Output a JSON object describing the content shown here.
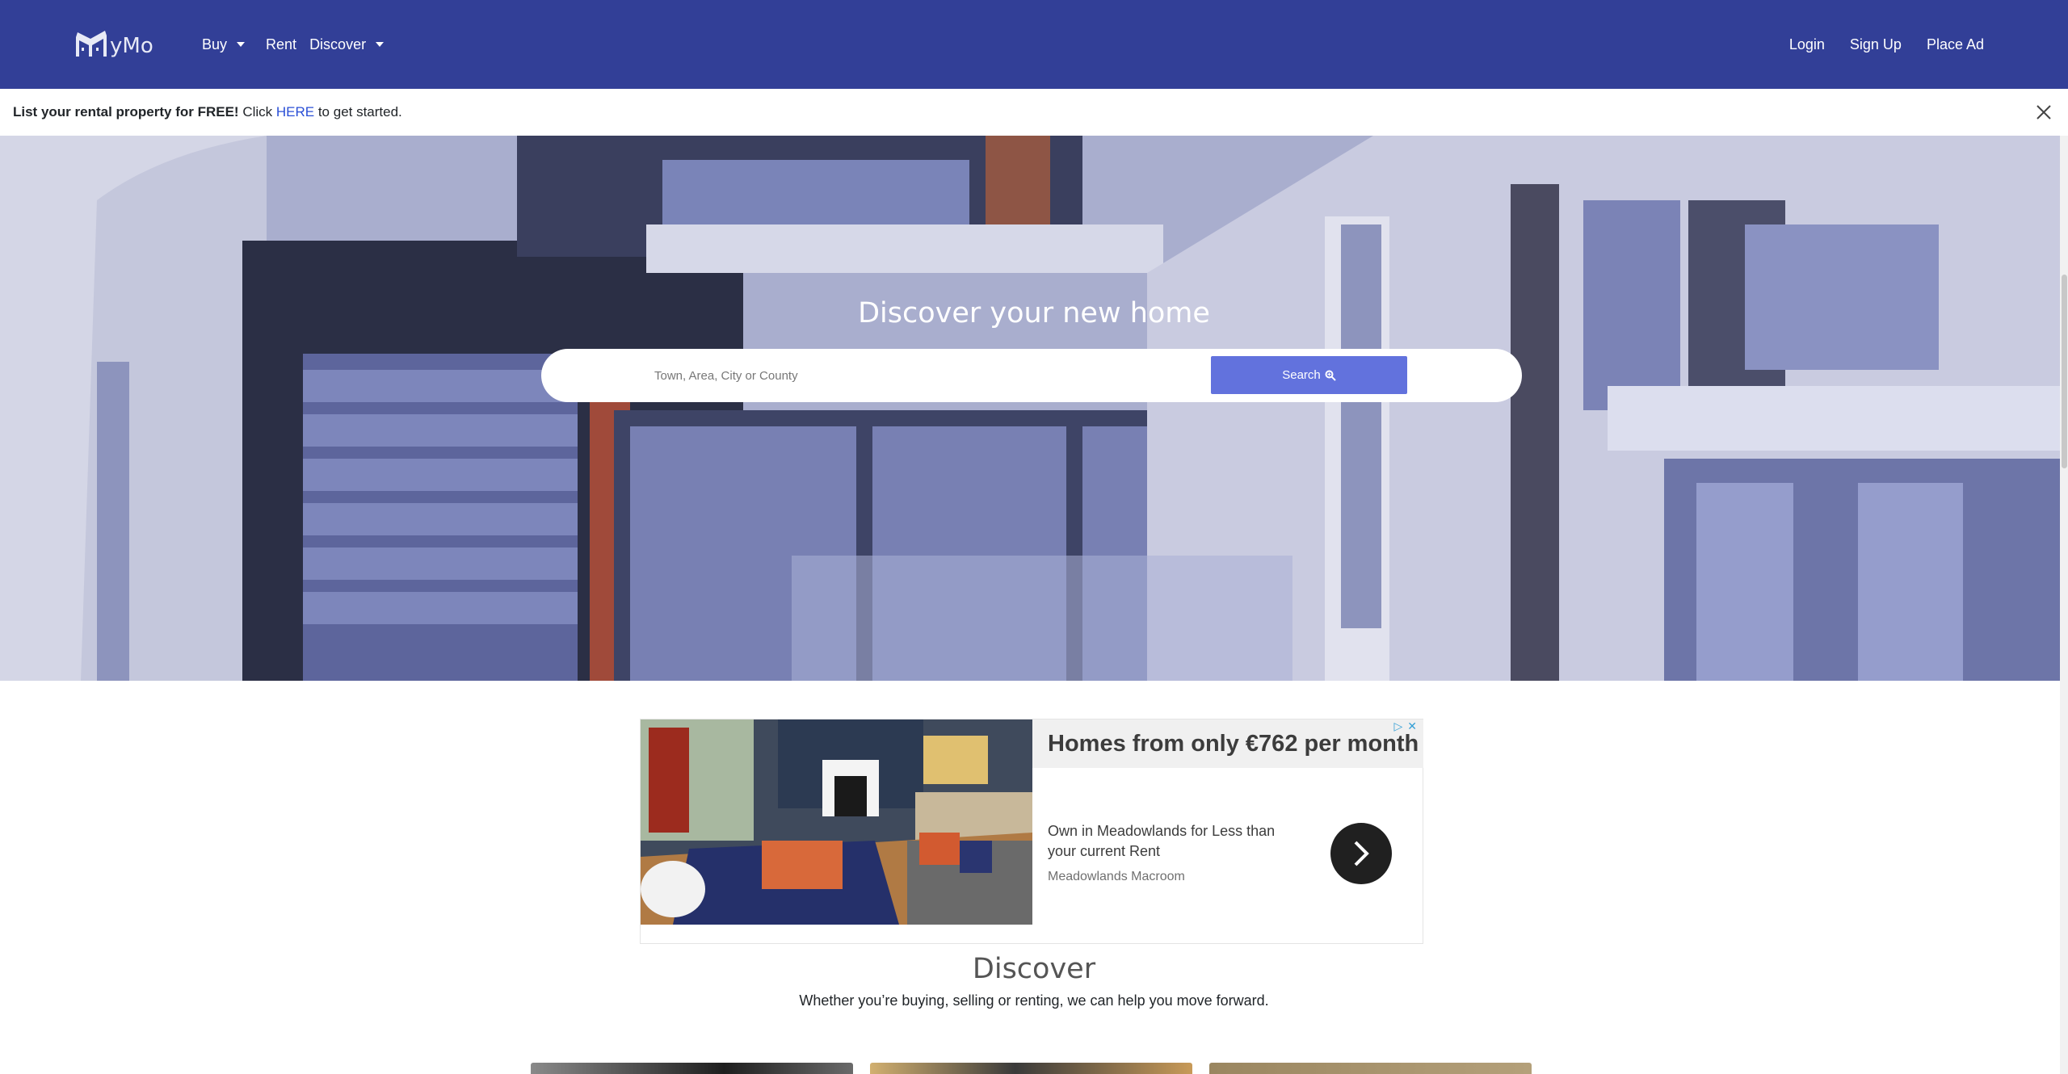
{
  "navbar": {
    "logo_text": "yMo",
    "left_items": [
      {
        "label": "Buy",
        "has_dropdown": true
      },
      {
        "label": "Rent",
        "has_dropdown": false
      },
      {
        "label": "Discover",
        "has_dropdown": true
      }
    ],
    "right_items": [
      {
        "label": "Login"
      },
      {
        "label": "Sign Up"
      },
      {
        "label": "Place Ad"
      }
    ],
    "color": "#323f97"
  },
  "announcement": {
    "bold_text": "List your rental property for FREE!",
    "text_before_link": " Click ",
    "link_text": "HERE",
    "text_after_link": " to get started."
  },
  "hero": {
    "title": "Discover your new home",
    "search_placeholder": "Town, Area, City or County",
    "search_button": "Search",
    "search_button_color": "#6272dd"
  },
  "ad": {
    "headline": "Homes from only €762 per month",
    "description": "Own in Meadowlands for Less than your current Rent",
    "source": "Meadowlands Macroom"
  },
  "discover": {
    "title": "Discover",
    "subtitle": "Whether you’re buying, selling or renting, we can help you move forward."
  }
}
